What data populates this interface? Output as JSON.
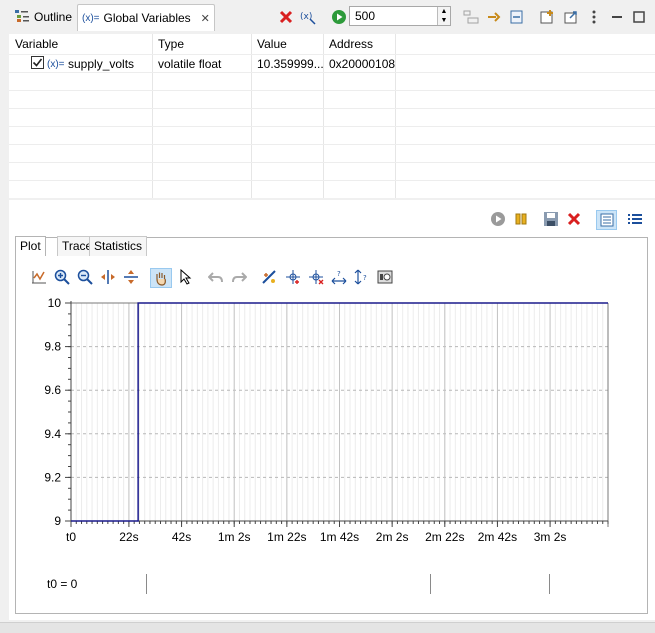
{
  "tabs": {
    "outline": "Outline",
    "global_variables": "Global Variables"
  },
  "toolbar": {
    "sample_rate": "500"
  },
  "table": {
    "headers": [
      "Variable",
      "Type",
      "Value",
      "Address"
    ],
    "rows": [
      {
        "checked": true,
        "var_prefix": "(x)=",
        "name": "supply_volts",
        "type": "volatile float",
        "value": "10.359999...",
        "address": "0x20000108"
      }
    ]
  },
  "plot_tabs": [
    "Plot",
    "Trace",
    "Statistics"
  ],
  "status": {
    "t0": "t0 = 0"
  },
  "chart_data": {
    "type": "line",
    "title": "",
    "xlabel": "",
    "ylabel": "",
    "x_unit": "s",
    "x_tick_labels": [
      "t0",
      "22s",
      "42s",
      "1m 2s",
      "1m 22s",
      "1m 42s",
      "2m 2s",
      "2m 22s",
      "2m 42s",
      "3m 2s"
    ],
    "x_tick_values": [
      0,
      22,
      42,
      62,
      82,
      102,
      122,
      142,
      162,
      182
    ],
    "y_tick_labels": [
      "10",
      "9.8",
      "9.6",
      "9.4",
      "9.2",
      "9"
    ],
    "y_tick_values": [
      10,
      9.8,
      9.6,
      9.4,
      9.2,
      9
    ],
    "xlim": [
      0,
      204
    ],
    "ylim": [
      9,
      10
    ],
    "grid": true,
    "series": [
      {
        "name": "supply_volts",
        "color": "#1a1a8c",
        "x": [
          0,
          25.5,
          25.5,
          204
        ],
        "y": [
          9,
          9,
          10,
          10
        ]
      }
    ]
  }
}
